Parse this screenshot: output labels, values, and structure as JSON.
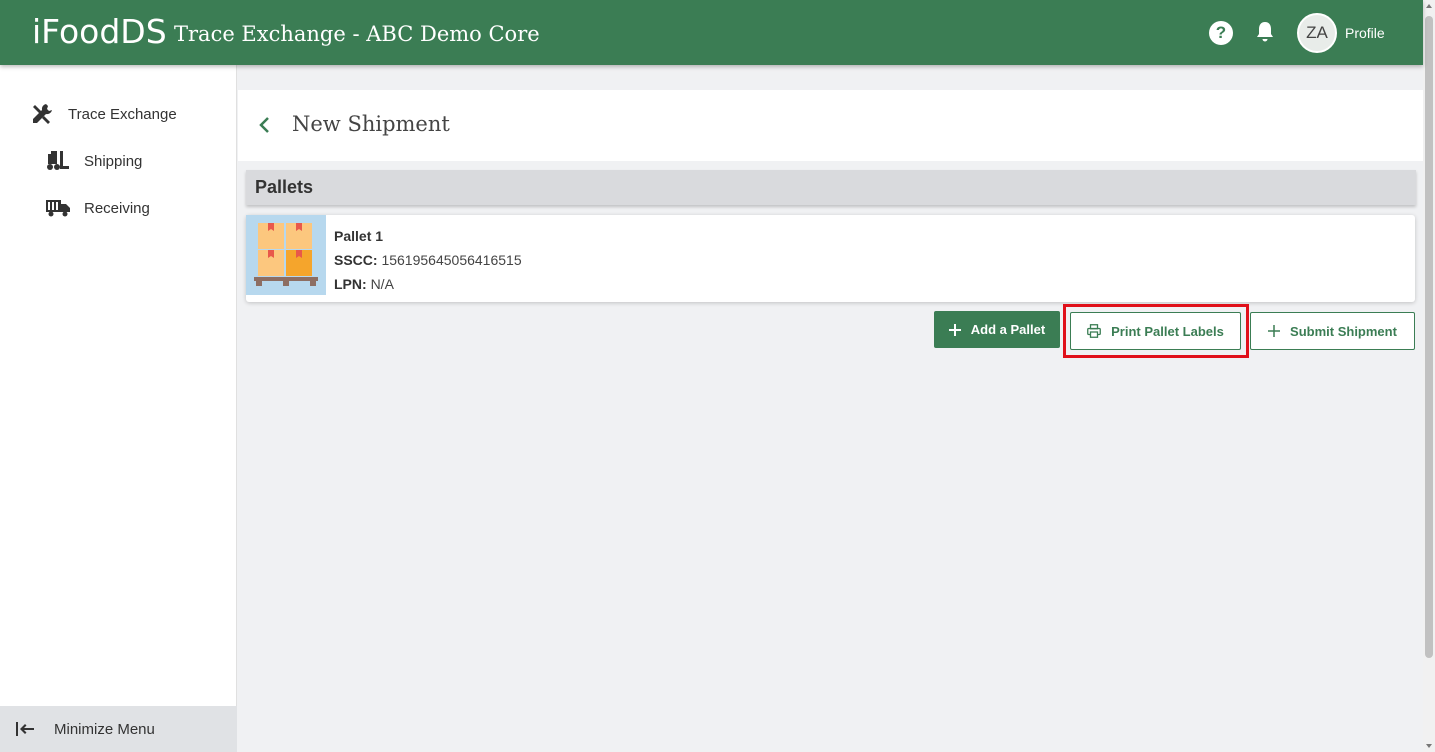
{
  "header": {
    "logo": "iFoodDS",
    "app_title": "Trace Exchange - ABC Demo Core",
    "help_icon": "question-icon",
    "notifications_icon": "bell-icon",
    "avatar_initials": "ZA",
    "profile_label": "Profile",
    "brand_color": "#3b7d54"
  },
  "sidebar": {
    "items": [
      {
        "label": "Trace Exchange",
        "icon": "tools-icon"
      },
      {
        "label": "Shipping",
        "icon": "forklift-icon"
      },
      {
        "label": "Receiving",
        "icon": "truck-icon"
      }
    ],
    "minimize_label": "Minimize Menu",
    "minimize_icon": "collapse-left-icon"
  },
  "page": {
    "title": "New Shipment",
    "back_icon": "chevron-left-icon",
    "section_title": "Pallets"
  },
  "pallets": [
    {
      "name": "Pallet 1",
      "sscc_label": "SSCC:",
      "sscc_value": "156195645056416515",
      "lpn_label": "LPN:",
      "lpn_value": "N/A",
      "image_icon": "pallet-boxes-icon"
    }
  ],
  "actions": {
    "add_pallet": "Add a Pallet",
    "print_labels": "Print Pallet Labels",
    "submit_shipment": "Submit Shipment",
    "highlight_color": "#e0101a"
  }
}
